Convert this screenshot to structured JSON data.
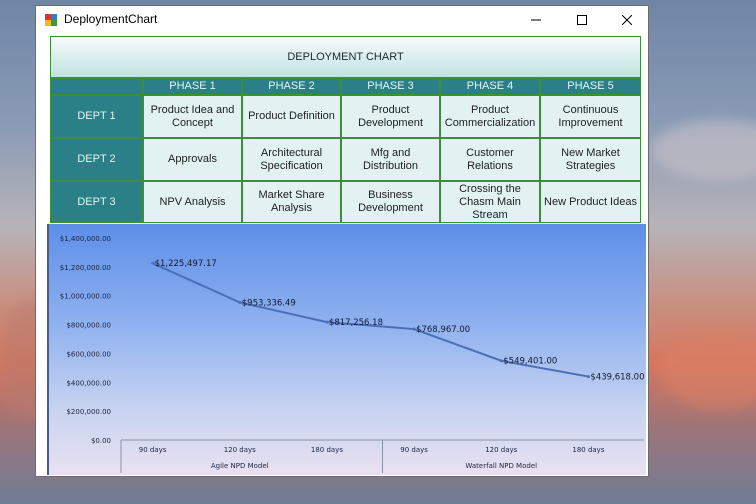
{
  "window": {
    "title": "DeploymentChart"
  },
  "controls": {
    "minimize": "—",
    "maximize": "☐",
    "close": "✕"
  },
  "table": {
    "title": "DEPLOYMENT CHART",
    "phases": [
      "PHASE 1",
      "PHASE 2",
      "PHASE 3",
      "PHASE 4",
      "PHASE 5"
    ],
    "rows": [
      {
        "dept": "DEPT 1",
        "cells": [
          "Product Idea and Concept",
          "Product Definition",
          "Product Development",
          "Product Commercialization",
          "Continuous Improvement"
        ]
      },
      {
        "dept": "DEPT 2",
        "cells": [
          "Approvals",
          "Architectural Specification",
          "Mfg and Distribution",
          "Customer Relations",
          "New Market Strategies"
        ]
      },
      {
        "dept": "DEPT 3",
        "cells": [
          "NPV Analysis",
          "Market Share Analysis",
          "Business Development",
          "Crossing the Chasm Main Stream",
          "New Product Ideas"
        ]
      }
    ]
  },
  "chart_data": {
    "type": "line",
    "y_ticks": [
      "$1,400,000.00",
      "$1,200,000.00",
      "$1,000,000.00",
      "$800,000.00",
      "$600,000.00",
      "$400,000.00",
      "$200,000.00",
      "$0.00"
    ],
    "ylim": [
      0,
      1400000
    ],
    "categories": [
      "90 days",
      "120 days",
      "180 days",
      "90 days",
      "120 days",
      "180 days"
    ],
    "groups": [
      "Agile NPD Model",
      "Waterfall NPD Model"
    ],
    "values": [
      1225497.17,
      953336.49,
      817256.18,
      768967.0,
      549401.0,
      439618.0
    ],
    "data_labels": [
      "$1,225,497.17",
      "$953,336.49",
      "$817,256.18",
      "$768,967.00",
      "$549,401.00",
      "$439,618.00"
    ],
    "line_color": "#4a6fb8"
  }
}
